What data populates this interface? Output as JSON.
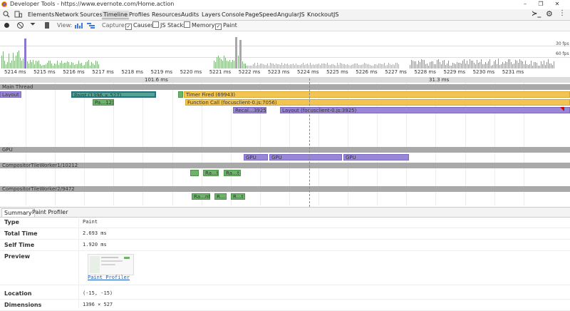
{
  "window": {
    "title": "Developer Tools - https://www.evernote.com/Home.action",
    "minimize": "–",
    "restore": "❐",
    "close": "✕"
  },
  "tabs": [
    {
      "label": "Elements"
    },
    {
      "label": "Network"
    },
    {
      "label": "Sources"
    },
    {
      "label": "Timeline",
      "active": true
    },
    {
      "label": "Profiles"
    },
    {
      "label": "Resources"
    },
    {
      "label": "Audits"
    },
    {
      "label": "Layers"
    },
    {
      "label": "Console"
    },
    {
      "label": "PageSpeed"
    },
    {
      "label": "AngularJS"
    },
    {
      "label": "KnockoutJS"
    }
  ],
  "toolbar": {
    "view_label": "View:",
    "capture_label": "Capture:",
    "causes_label": "Causes",
    "causes_checked": true,
    "jsstacks_label": "JS Stacks",
    "jsstacks_checked": false,
    "memory_label": "Memory",
    "memory_checked": false,
    "paint_label": "Paint",
    "paint_checked": true
  },
  "overview": {
    "fps30": "30 fps",
    "fps60": "60 fps"
  },
  "ruler": {
    "ticks": [
      "5214 ms",
      "5215 ms",
      "5216 ms",
      "5217 ms",
      "5218 ms",
      "5219 ms",
      "5220 ms",
      "5221 ms",
      "5222 ms",
      "5223 ms",
      "5224 ms",
      "5225 ms",
      "5226 ms",
      "5227 ms",
      "5228 ms",
      "5229 ms",
      "5230 ms",
      "5231 ms"
    ],
    "selection_left": "101.6 ms",
    "selection_right": "31.3 ms"
  },
  "tracks": {
    "main_thread": "Main Thread",
    "gpu": "GPU",
    "worker1": "CompositorTileWorker1/10212",
    "worker2": "CompositorTileWorker2/9472"
  },
  "events": {
    "layout1": "Layout",
    "paint1": "Paint (1396 × 527)",
    "paint2": "Pa…12)",
    "timer": "Timer Fired (69943)",
    "function_call": "Function Call (focusclient-0.js:7056)",
    "recalc": "Recal…3925)",
    "layout2": "Layout (focusclient-0.js:3925)",
    "gpu1": "GPU",
    "gpu2": "GPU",
    "gpu3": "GPU",
    "w1a": "",
    "w1b": "Ra…t",
    "w1c": "Ra…t",
    "w2a": "Ra…nt",
    "w2b": "R…",
    "w2c": "R…t"
  },
  "bottom_tabs": [
    "Summary",
    "Paint Profiler"
  ],
  "summary": {
    "type_label": "Type",
    "type_value": "Paint",
    "total_label": "Total Time",
    "total_value": "2.693 ms",
    "self_label": "Self Time",
    "self_value": "1.920 ms",
    "preview_label": "Preview",
    "paint_profiler_link": "Paint Profiler",
    "location_label": "Location",
    "location_value": "(-15, -15)",
    "dimensions_label": "Dimensions",
    "dimensions_value": "1396 × 527"
  }
}
